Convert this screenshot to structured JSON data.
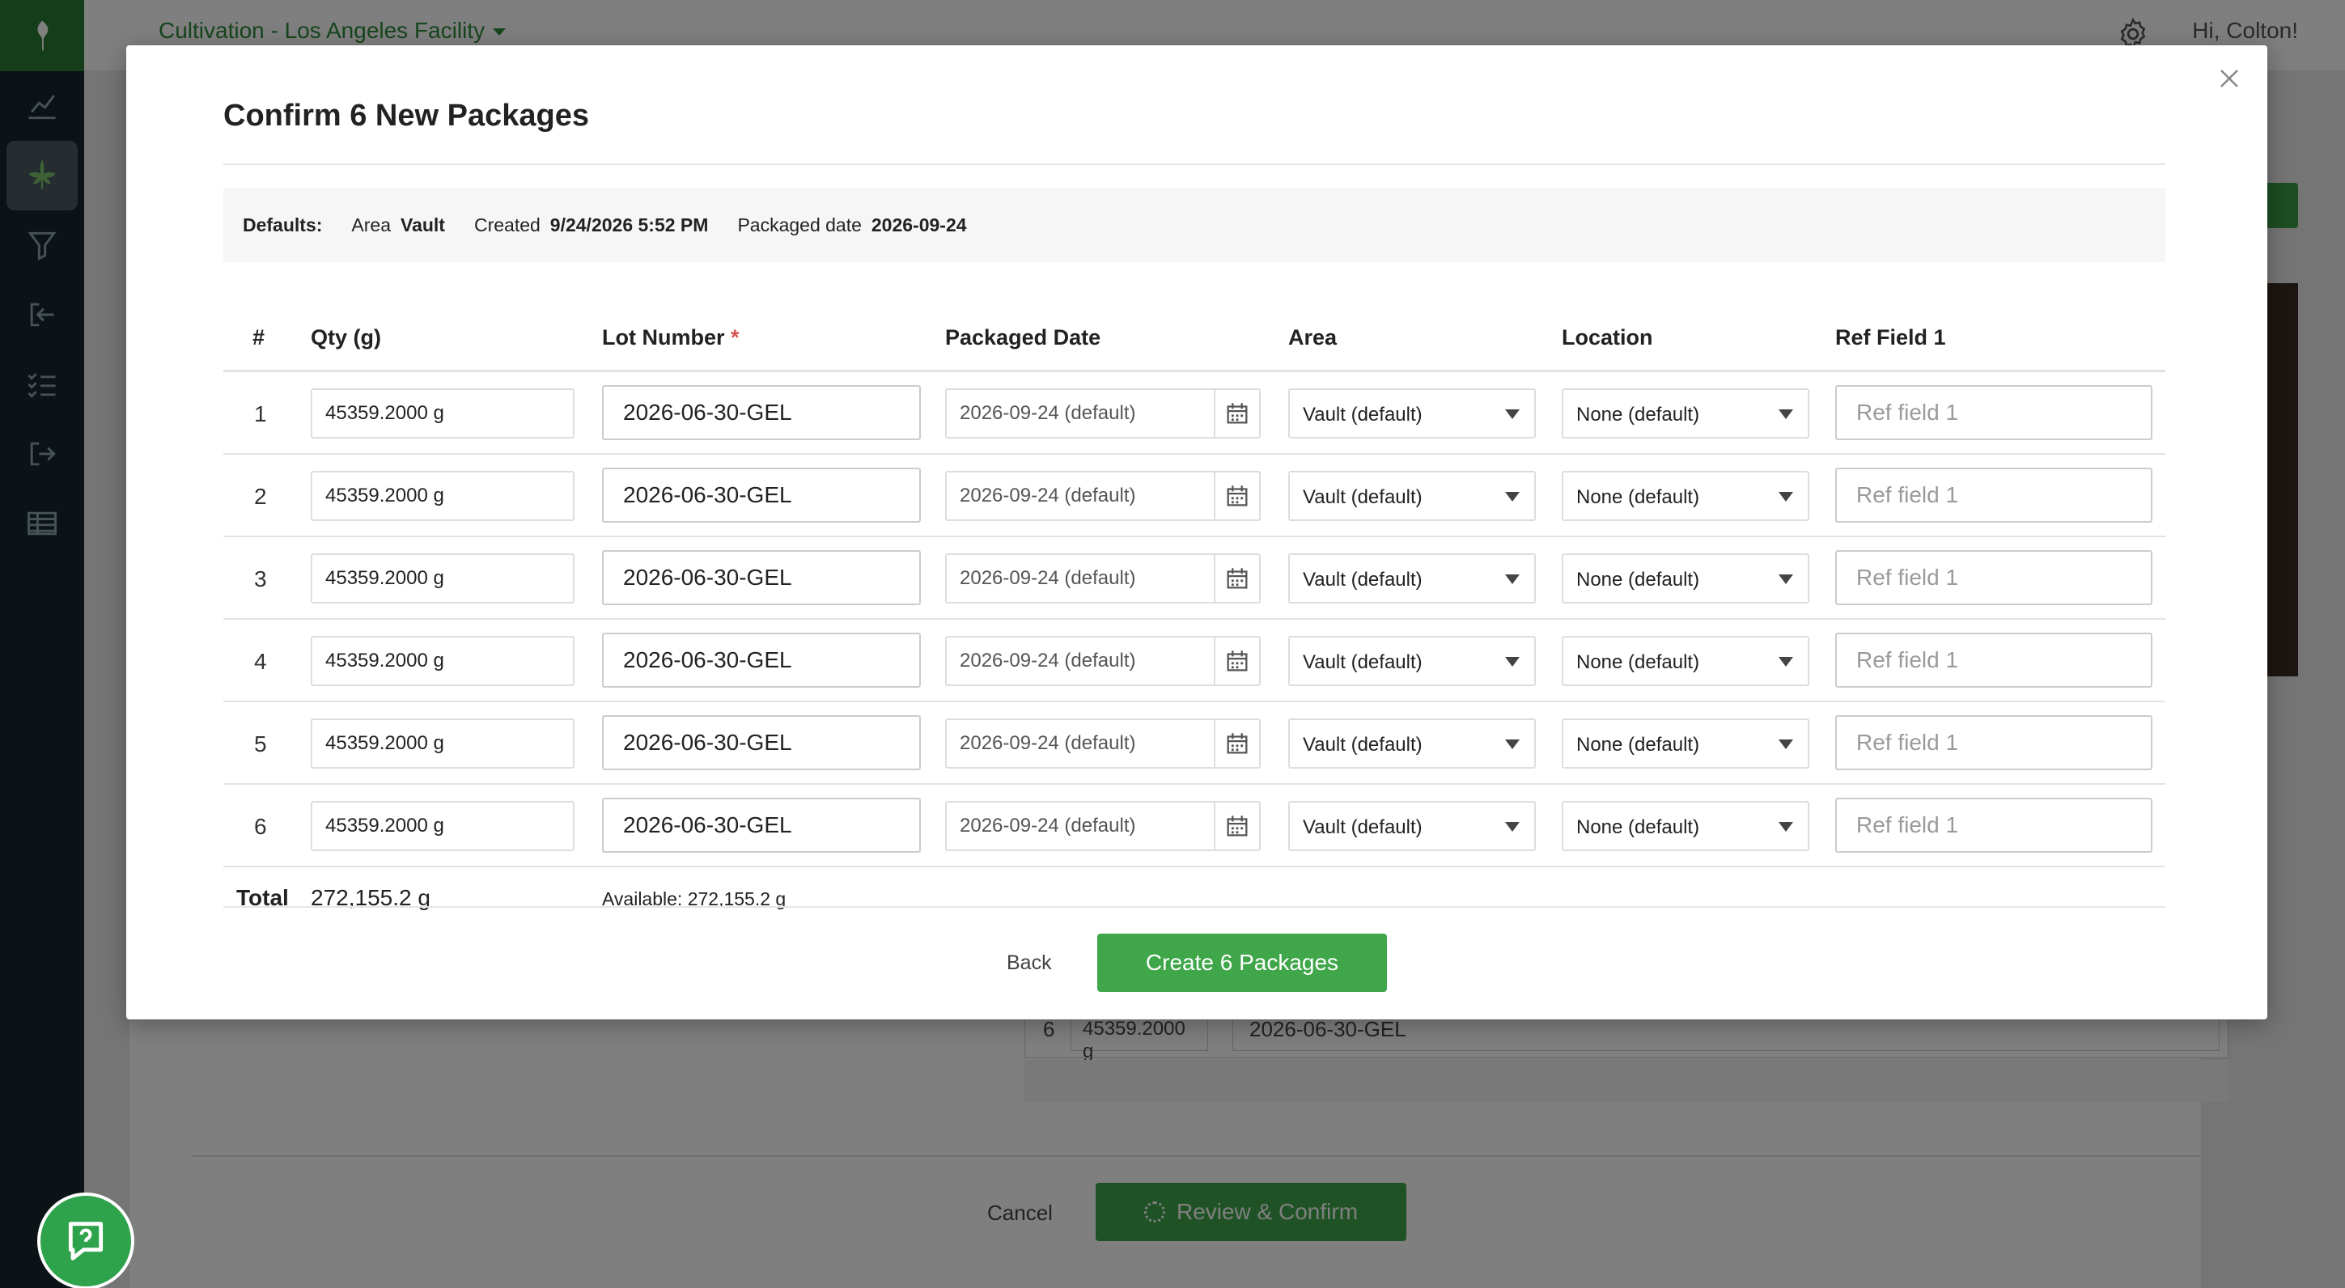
{
  "app": {
    "facility": "Cultivation - Los Angeles Facility",
    "greeting": "Hi, Colton!"
  },
  "background": {
    "row": {
      "index": "6",
      "qty": "45359.2000 g",
      "lot": "2026-06-30-GEL"
    },
    "cancel_label": "Cancel",
    "review_label": "Review & Confirm"
  },
  "modal": {
    "title": "Confirm 6 New Packages",
    "defaults": {
      "label": "Defaults:",
      "area_key": "Area",
      "area_value": "Vault",
      "created_key": "Created",
      "created_value": "9/24/2026 5:52 PM",
      "packaged_key": "Packaged date",
      "packaged_value": "2026-09-24"
    },
    "columns": {
      "num": "#",
      "qty": "Qty (g)",
      "lot": "Lot Number",
      "lot_required": "*",
      "packaged": "Packaged Date",
      "area": "Area",
      "location": "Location",
      "ref": "Ref Field 1"
    },
    "rows": [
      {
        "index": "1",
        "qty": "45359.2000 g",
        "lot": "2026-06-30-GEL",
        "date": "2026-09-24 (default)",
        "area": "Vault (default)",
        "location": "None (default)",
        "ref_placeholder": "Ref field 1"
      },
      {
        "index": "2",
        "qty": "45359.2000 g",
        "lot": "2026-06-30-GEL",
        "date": "2026-09-24 (default)",
        "area": "Vault (default)",
        "location": "None (default)",
        "ref_placeholder": "Ref field 1"
      },
      {
        "index": "3",
        "qty": "45359.2000 g",
        "lot": "2026-06-30-GEL",
        "date": "2026-09-24 (default)",
        "area": "Vault (default)",
        "location": "None (default)",
        "ref_placeholder": "Ref field 1"
      },
      {
        "index": "4",
        "qty": "45359.2000 g",
        "lot": "2026-06-30-GEL",
        "date": "2026-09-24 (default)",
        "area": "Vault (default)",
        "location": "None (default)",
        "ref_placeholder": "Ref field 1"
      },
      {
        "index": "5",
        "qty": "45359.2000 g",
        "lot": "2026-06-30-GEL",
        "date": "2026-09-24 (default)",
        "area": "Vault (default)",
        "location": "None (default)",
        "ref_placeholder": "Ref field 1"
      },
      {
        "index": "6",
        "qty": "45359.2000 g",
        "lot": "2026-06-30-GEL",
        "date": "2026-09-24 (default)",
        "area": "Vault (default)",
        "location": "None (default)",
        "ref_placeholder": "Ref field 1"
      }
    ],
    "total": {
      "label": "Total",
      "value": "272,155.2 g",
      "available": "Available: 272,155.2 g"
    },
    "back_label": "Back",
    "create_label": "Create 6 Packages"
  },
  "colors": {
    "brand_green": "#3fa64a",
    "sidebar": "#16262f",
    "required": "#d9534f"
  }
}
